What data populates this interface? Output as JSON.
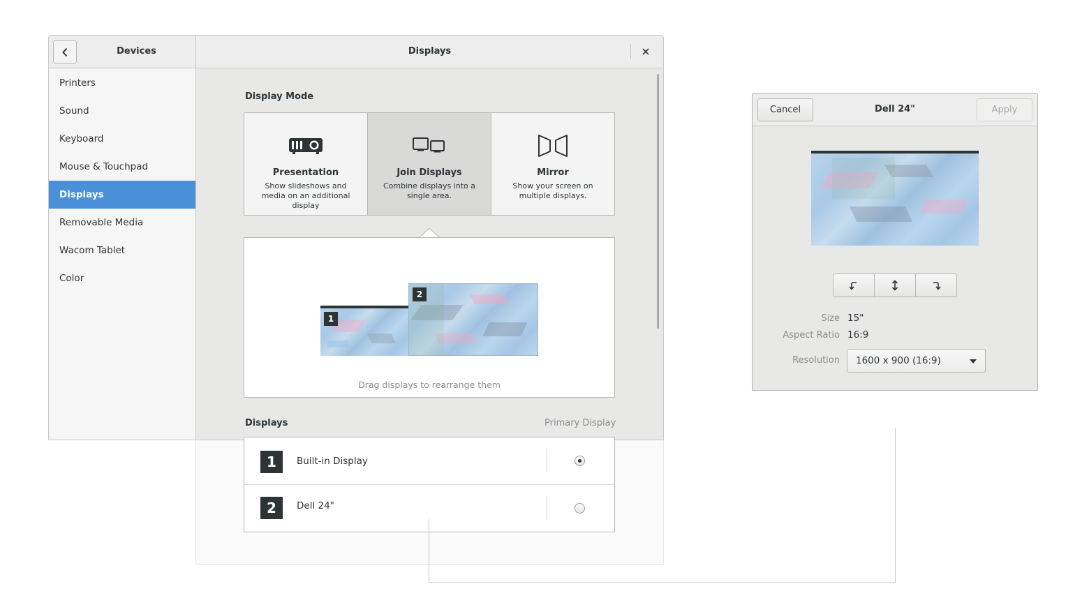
{
  "sidebar": {
    "title": "Devices",
    "items": [
      {
        "label": "Printers"
      },
      {
        "label": "Sound"
      },
      {
        "label": "Keyboard"
      },
      {
        "label": "Mouse & Touchpad"
      },
      {
        "label": "Displays",
        "active": true
      },
      {
        "label": "Removable Media"
      },
      {
        "label": "Wacom Tablet"
      },
      {
        "label": "Color"
      }
    ]
  },
  "main": {
    "title": "Displays",
    "display_mode_label": "Display Mode",
    "modes": [
      {
        "title": "Presentation",
        "desc": "Show slideshows and media on an additional display",
        "icon": "projector-icon"
      },
      {
        "title": "Join Displays",
        "desc": "Combine displays into a single area.",
        "icon": "join-displays-icon",
        "selected": true
      },
      {
        "title": "Mirror",
        "desc": "Show your screen on multiple displays.",
        "icon": "mirror-icon"
      }
    ],
    "arrange_hint": "Drag displays to rearrange them",
    "monitor_badges": [
      "1",
      "2"
    ],
    "displays_label": "Displays",
    "primary_label": "Primary Display",
    "displays": [
      {
        "num": "1",
        "name": "Built-in Display",
        "primary": true
      },
      {
        "num": "2",
        "name": "Dell 24\"",
        "primary": false
      }
    ]
  },
  "dialog": {
    "title": "Dell 24\"",
    "cancel_label": "Cancel",
    "apply_label": "Apply",
    "size_label": "Size",
    "size_value": "15\"",
    "aspect_label": "Aspect Ratio",
    "aspect_value": "16:9",
    "resolution_label": "Resolution",
    "resolution_value": "1600 x 900 (16:9)"
  },
  "colors": {
    "accent": "#4a90d9",
    "badge": "#2e3436"
  }
}
